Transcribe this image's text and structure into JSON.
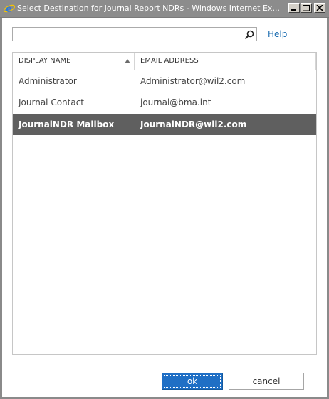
{
  "window": {
    "title": "Select Destination for Journal Report NDRs - Windows Internet Ex..."
  },
  "search": {
    "value": "",
    "placeholder": ""
  },
  "help": {
    "label": "Help"
  },
  "table": {
    "columns": [
      "DISPLAY NAME",
      "EMAIL ADDRESS"
    ],
    "rows": [
      {
        "name": "Administrator",
        "email": "Administrator@wil2.com"
      },
      {
        "name": "Journal Contact",
        "email": "journal@bma.int"
      },
      {
        "name": "JournalNDR Mailbox",
        "email": "JournalNDR@wil2.com"
      }
    ],
    "selected_index": 2
  },
  "buttons": {
    "ok": "ok",
    "cancel": "cancel"
  },
  "colors": {
    "accent": "#1f6fc5",
    "selected_row": "#5f5f5f",
    "link": "#1f6fb2"
  },
  "icons": [
    "ie-icon",
    "minimize-icon",
    "maximize-icon",
    "close-icon",
    "search-icon",
    "sort-ascending-icon"
  ]
}
